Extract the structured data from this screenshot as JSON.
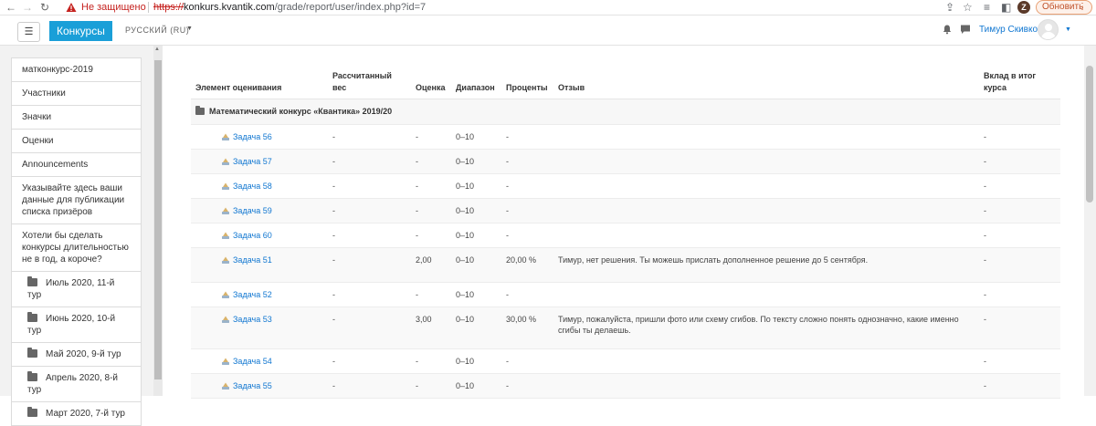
{
  "browser": {
    "insecure_label": "Не защищено",
    "url_scheme": "https://",
    "url_host": "konkurs.kvantik.com",
    "url_path": "/grade/report/user/index.php?id=7",
    "profile_initial": "Z",
    "update_label": "Обновить"
  },
  "navbar": {
    "menu_icon": "☰",
    "brand": "Конкурсы",
    "language": "РУССКИЙ (RU)",
    "username": "Тимур Скивко"
  },
  "sidebar": {
    "items": [
      {
        "label": "матконкурс-2019"
      },
      {
        "label": "Участники"
      },
      {
        "label": "Значки"
      },
      {
        "label": "Оценки"
      },
      {
        "label": "Announcements"
      },
      {
        "label": "Указывайте здесь ваши данные для публикации списка призёров"
      },
      {
        "label": "Хотели бы сделать конкурсы длительностью не в год, а короче?"
      }
    ],
    "folders": [
      {
        "label": "Июль 2020, 11-й тур"
      },
      {
        "label": "Июнь 2020, 10-й тур"
      },
      {
        "label": "Май 2020, 9-й тур"
      },
      {
        "label": "Апрель 2020, 8-й тур"
      },
      {
        "label": "Март 2020, 7-й тур"
      }
    ]
  },
  "table": {
    "headers": {
      "item": "Элемент оценивания",
      "weight": "Рассчитанный вес",
      "grade": "Оценка",
      "range": "Диапазон",
      "percent": "Проценты",
      "feedback": "Отзыв",
      "contribution": "Вклад в итог курса"
    },
    "category": "Математический конкурс «Квантика» 2019/20",
    "rows": [
      {
        "name": "Задача 56",
        "weight": "-",
        "grade": "-",
        "range": "0–10",
        "percent": "-",
        "feedback": "",
        "contribution": "-"
      },
      {
        "name": "Задача 57",
        "weight": "-",
        "grade": "-",
        "range": "0–10",
        "percent": "-",
        "feedback": "",
        "contribution": "-"
      },
      {
        "name": "Задача 58",
        "weight": "-",
        "grade": "-",
        "range": "0–10",
        "percent": "-",
        "feedback": "",
        "contribution": "-"
      },
      {
        "name": "Задача 59",
        "weight": "-",
        "grade": "-",
        "range": "0–10",
        "percent": "-",
        "feedback": "",
        "contribution": "-"
      },
      {
        "name": "Задача 60",
        "weight": "-",
        "grade": "-",
        "range": "0–10",
        "percent": "-",
        "feedback": "",
        "contribution": "-"
      },
      {
        "name": "Задача 51",
        "weight": "-",
        "grade": "2,00",
        "range": "0–10",
        "percent": "20,00 %",
        "feedback": "Тимур, нет решения. Ты можешь прислать дополненное решение до 5 сентября.",
        "contribution": "-"
      },
      {
        "name": "Задача 52",
        "weight": "-",
        "grade": "-",
        "range": "0–10",
        "percent": "-",
        "feedback": "",
        "contribution": "-"
      },
      {
        "name": "Задача 53",
        "weight": "-",
        "grade": "3,00",
        "range": "0–10",
        "percent": "30,00 %",
        "feedback": "Тимур, пожалуйста, пришли фото или схему сгибов. По тексту сложно понять однозначно, какие именно сгибы ты делаешь.",
        "contribution": "-"
      },
      {
        "name": "Задача 54",
        "weight": "-",
        "grade": "-",
        "range": "0–10",
        "percent": "-",
        "feedback": "",
        "contribution": "-"
      },
      {
        "name": "Задача 55",
        "weight": "-",
        "grade": "-",
        "range": "0–10",
        "percent": "-",
        "feedback": "",
        "contribution": "-"
      }
    ]
  }
}
